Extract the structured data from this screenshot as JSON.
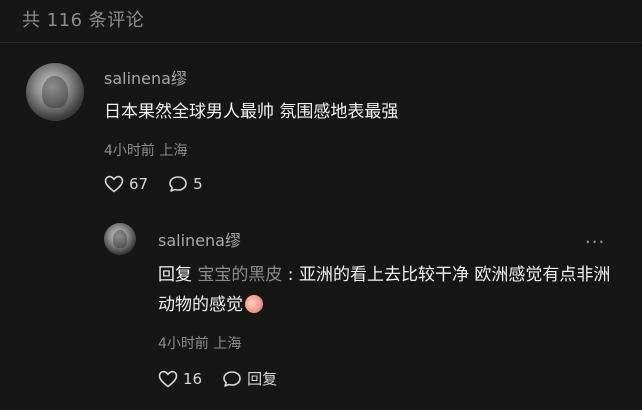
{
  "header": {
    "comment_count_label": "共 116 条评论"
  },
  "comment": {
    "username": "salinena缪",
    "text": "日本果然全球男人最帅 氛围感地表最强",
    "meta": "4小时前 上海",
    "like_count": "67",
    "reply_count": "5"
  },
  "reply": {
    "username": "salinena缪",
    "prefix": "回复 ",
    "target": "宝宝的黑皮",
    "text": " : 亚洲的看上去比较干净 欧洲感觉有点非洲动物的感觉",
    "meta": "4小时前 上海",
    "like_count": "16",
    "reply_label": "回复",
    "more_label": "···"
  },
  "icons": {
    "like": "heart-outline-icon",
    "comment": "speech-bubble-icon",
    "emoji": "peach-emoji-icon",
    "more": "more-dots-icon"
  }
}
